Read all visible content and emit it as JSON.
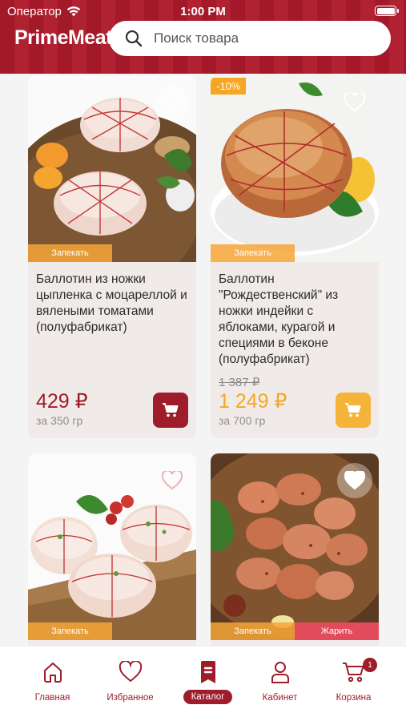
{
  "status": {
    "carrier": "Оператор",
    "time": "1:00 PM"
  },
  "header": {
    "logo": "PrimeMeat",
    "search_placeholder": "Поиск товара"
  },
  "products": [
    {
      "title": "Баллотин из ножки цыпленка с моцареллой и вялеными томатами (полуфабрикат)",
      "price": "429 ₽",
      "weight": "за 350 гр",
      "tags": [
        "Запекать"
      ],
      "favorite": false
    },
    {
      "discount": "-10%",
      "title": "Баллотин \"Рождественский\" из ножки индейки с яблоками, курагой и специями в беконе (полуфабрикат)",
      "old_price": "1 387 ₽",
      "price": "1 249 ₽",
      "weight": "за 700 гр",
      "tags": [
        "Запекать"
      ],
      "favorite": false
    },
    {
      "tags": [
        "Запекать"
      ],
      "favorite": false
    },
    {
      "tags": [
        "Запекать",
        "Жарить"
      ],
      "favorite": true
    }
  ],
  "tabbar": {
    "items": [
      {
        "label": "Главная",
        "icon": "home-icon"
      },
      {
        "label": "Избранное",
        "icon": "heart-icon"
      },
      {
        "label": "Каталог",
        "icon": "catalog-icon",
        "active": true
      },
      {
        "label": "Кабинет",
        "icon": "user-icon"
      },
      {
        "label": "Корзина",
        "icon": "cart-icon",
        "badge": "1"
      }
    ]
  },
  "colors": {
    "brand": "#9f1d2b",
    "accent": "#f6a623",
    "fry": "#e24b5c"
  }
}
